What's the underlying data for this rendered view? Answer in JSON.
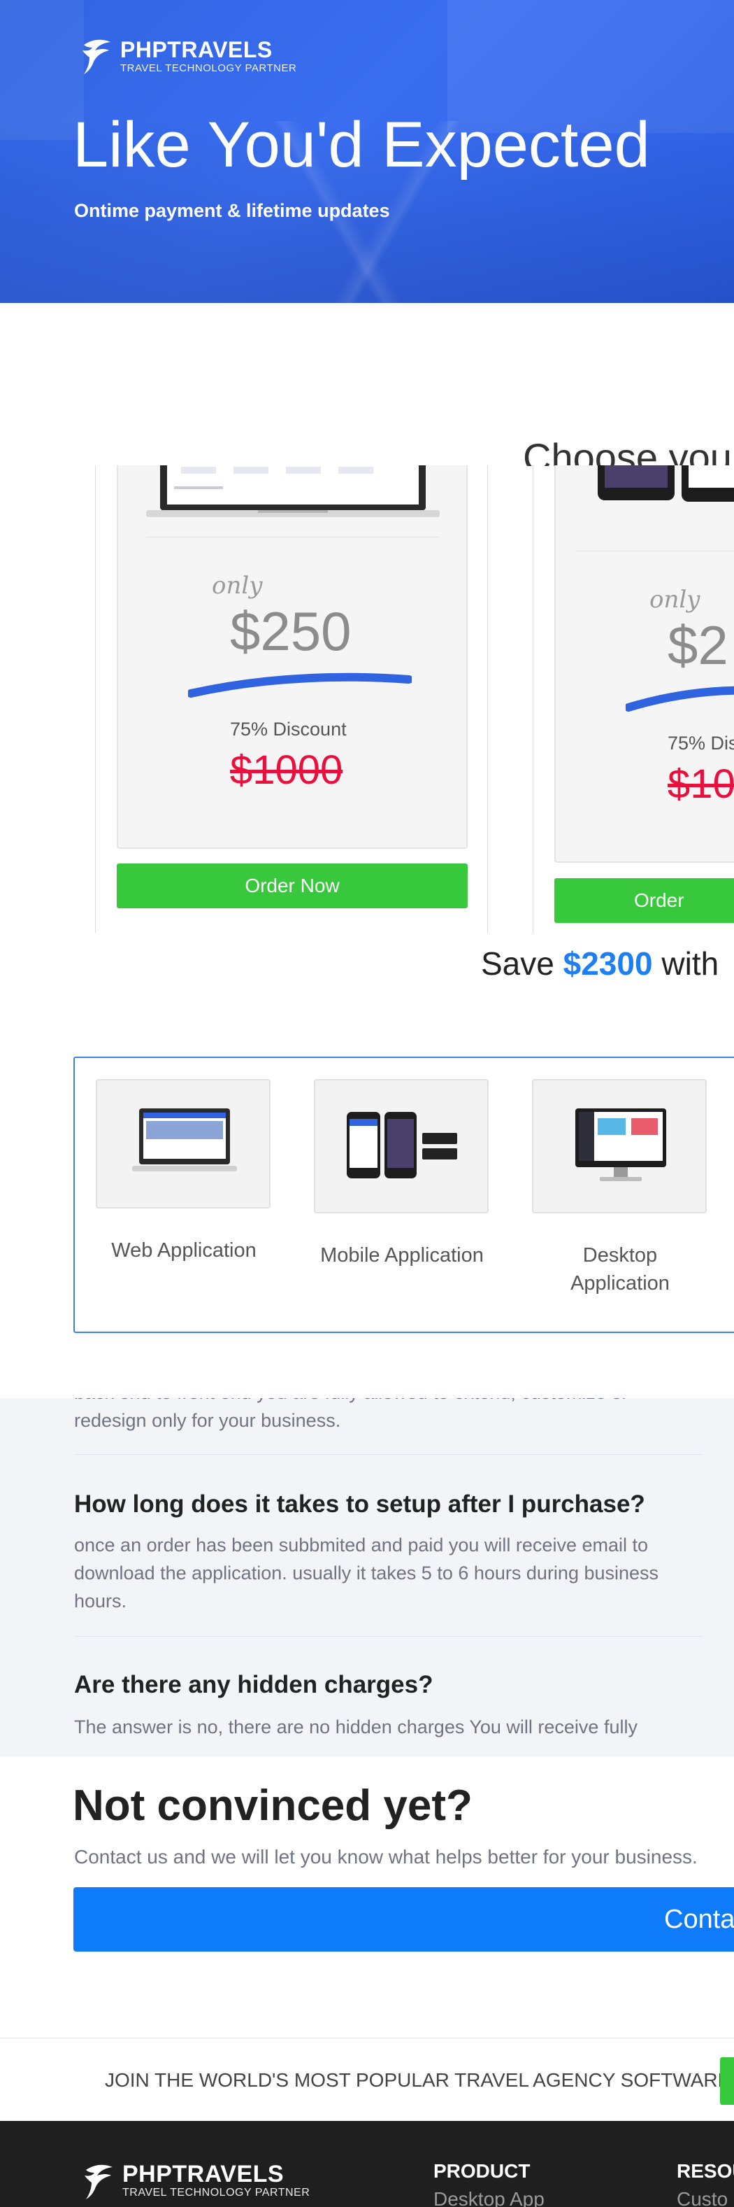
{
  "brand": {
    "name": "PHPTRAVELS",
    "tagline": "TRAVEL TECHNOLOGY PARTNER"
  },
  "hero": {
    "title": "Like You'd Expected",
    "subtitle": "Ontime payment & lifetime updates"
  },
  "pricing": {
    "title": "Choose your",
    "plans": [
      {
        "only_label": "only",
        "price": "$250",
        "discount": "75% Discount",
        "old_price": "$1000",
        "button": "Order Now"
      },
      {
        "only_label": "only",
        "price": "$2",
        "discount": "75% Dis",
        "old_price": "$10",
        "button": "Order"
      }
    ]
  },
  "save": {
    "prefix": "Save",
    "amount": "$2300",
    "suffix": "with"
  },
  "apps": [
    {
      "label": "Web Application",
      "icon": "laptop-icon"
    },
    {
      "label": "Mobile Application",
      "icon": "smartphone-icon"
    },
    {
      "label": "Desktop Application",
      "icon": "desktop-monitor-icon"
    }
  ],
  "faq": {
    "partial_answer_line1": "back end to front end you are fully allowed to extend, customize or",
    "partial_answer_line2": "redesign only for your business.",
    "items": [
      {
        "question": "How long does it takes to setup after I purchase?",
        "answer": "once an order has been subbmited and paid you will receive email to download the application. usually it takes 5 to 6 hours during business hours."
      },
      {
        "question": "Are there any hidden charges?",
        "answer": "The answer is no, there are no hidden charges You will receive fully"
      }
    ]
  },
  "contact": {
    "title": "Not convinced yet?",
    "subtitle": "Contact us and we will let you know what helps better for your business.",
    "button": "Conta"
  },
  "join": {
    "text": "JOIN THE WORLD'S MOST POPULAR TRAVEL AGENCY SOFTWARE"
  },
  "footer": {
    "columns": [
      {
        "heading": "PRODUCT",
        "link": "Desktop App"
      },
      {
        "heading": "RESOU",
        "link": "Custo"
      }
    ]
  },
  "colors": {
    "hero_blue": "#2f63e0",
    "order_green": "#37c93b",
    "price_red": "#e8103c",
    "accent_blue": "#1e7ff0",
    "contact_blue": "#0d7bfa",
    "footer_dark": "#1f1f1f"
  }
}
